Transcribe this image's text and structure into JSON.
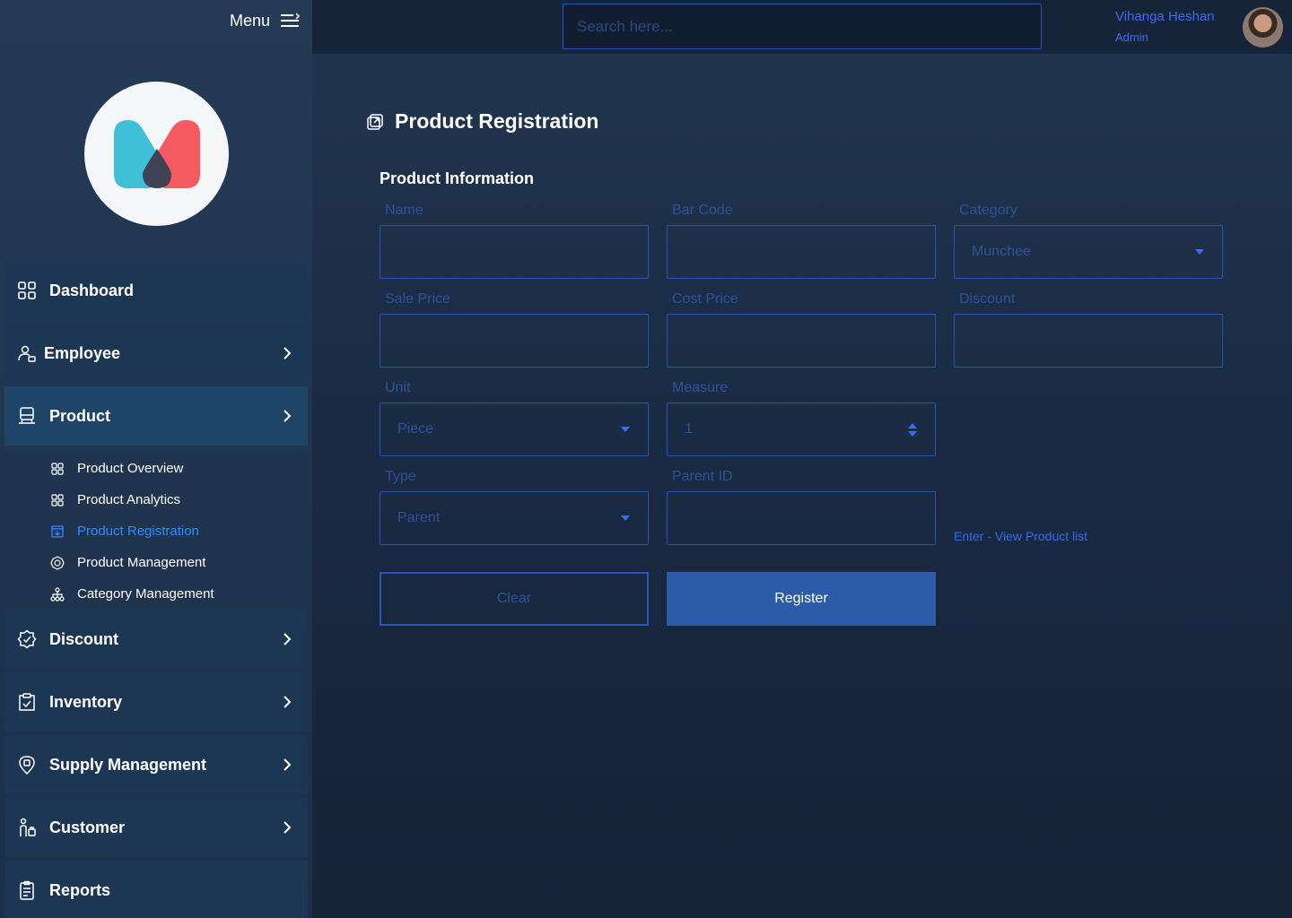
{
  "sidebar": {
    "menu_label": "Menu",
    "nav": {
      "dashboard": "Dashboard",
      "employee": "Employee",
      "product": "Product",
      "discount": "Discount",
      "inventory": "Inventory",
      "supply": "Supply Management",
      "customer": "Customer",
      "reports": "Reports"
    },
    "product_sub": {
      "overview": "Product Overview",
      "analytics": "Product Analytics",
      "registration": "Product Registration",
      "management": "Product Management",
      "category": "Category Management"
    },
    "active_item": "Product Registration"
  },
  "header": {
    "search_placeholder": "Search here...",
    "user_name": "Vihanga Heshan",
    "user_role": "Admin"
  },
  "main": {
    "page_title": "Product Registration",
    "section_title": "Product Information",
    "fields": {
      "name_label": "Name",
      "barcode_label": "Bar Code",
      "category_label": "Category",
      "category_value": "Munchee",
      "sale_price_label": "Sale Price",
      "cost_price_label": "Cost Price",
      "discount_label": "Discount",
      "unit_label": "Unit",
      "unit_value": "Piece",
      "measure_label": "Measure",
      "measure_value": "1",
      "type_label": "Type",
      "type_value": "Parent",
      "parent_id_label": "Parent ID"
    },
    "view_list_link": "Enter - View Product list",
    "clear_label": "Clear",
    "register_label": "Register"
  },
  "colors": {
    "accent": "#2e6cf0",
    "field_border": "#2a55b8",
    "register_bg": "#2d5ba8",
    "logo_teal": "#3fc0d6",
    "logo_red": "#f45a5f",
    "logo_dark": "#3f4356"
  },
  "icons": [
    "menu-icon",
    "dashboard-icon",
    "employee-icon",
    "product-icon",
    "discount-icon",
    "inventory-icon",
    "supply-icon",
    "customer-icon",
    "reports-icon",
    "chevron-right-icon",
    "external-link-icon",
    "dropdown-icon",
    "spinner-icon"
  ]
}
